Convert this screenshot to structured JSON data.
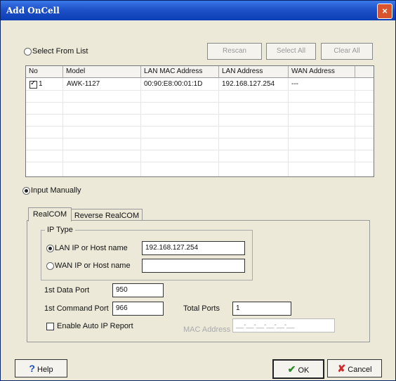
{
  "window": {
    "title": "Add OnCell",
    "close_glyph": "×"
  },
  "select_from_list": {
    "label": "Select From List",
    "selected": false
  },
  "list_buttons": {
    "rescan": "Rescan",
    "select_all": "Select All",
    "clear_all": "Clear All"
  },
  "table": {
    "columns": [
      "No",
      "Model",
      "LAN MAC Address",
      "LAN Address",
      "WAN Address"
    ],
    "rows": [
      {
        "checked": true,
        "no": "1",
        "model": "AWK-1127",
        "lan_mac": "00:90:E8:00:01:1D",
        "lan_address": "192.168.127.254",
        "wan_address": "---"
      }
    ]
  },
  "input_manually": {
    "label": "Input Manually",
    "selected": true
  },
  "tabs": [
    "RealCOM",
    "Reverse RealCOM"
  ],
  "ip_type": {
    "label": "IP Type",
    "lan_option": "LAN IP or Host name",
    "lan_value": "192.168.127.254",
    "wan_option": "WAN IP or Host name",
    "wan_value": ""
  },
  "ports": {
    "data_port_label": "1st Data Port",
    "data_port_value": "950",
    "command_port_label": "1st Command Port",
    "command_port_value": "966",
    "total_ports_label": "Total Ports",
    "total_ports_value": "1"
  },
  "auto_ip": {
    "label": "Enable Auto IP Report",
    "checked": false
  },
  "mac_address": {
    "label": "MAC Address",
    "value": "__-__-__-__-__-__"
  },
  "footer": {
    "help": "Help",
    "ok": "OK",
    "cancel": "Cancel"
  },
  "colors": {
    "title_bar": "#1f52c9",
    "dialog_bg": "#ece9d8",
    "close": "#d9532f",
    "ok_check": "#2a8c2a",
    "cancel_x": "#d12b2b",
    "help_q": "#1d4fc2"
  }
}
